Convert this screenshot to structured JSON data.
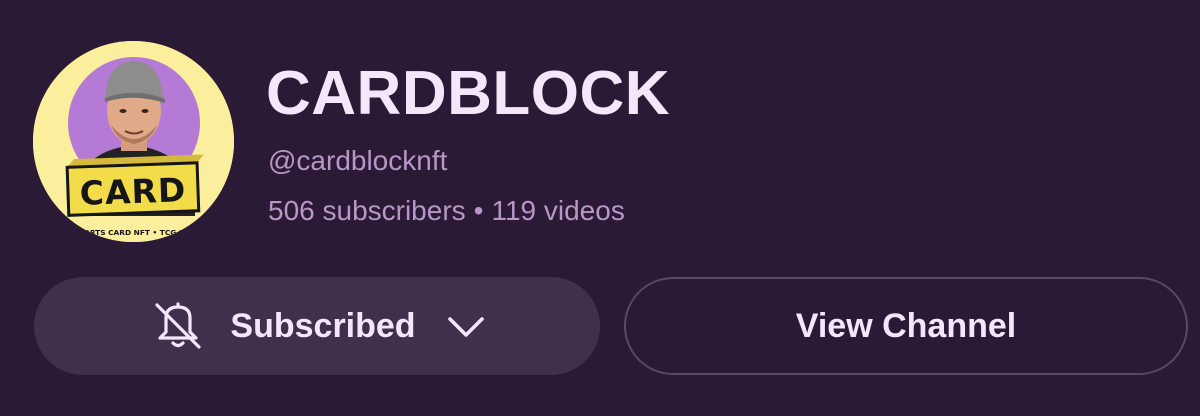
{
  "channel": {
    "name": "CARDBLOCK",
    "handle": "@cardblocknft",
    "subscribers": "506 subscribers",
    "separator": "•",
    "videos": "119 videos"
  },
  "avatar": {
    "badge_text": "CARD",
    "tagline": "SPORTS CARD NFT • TCG NFT",
    "colors": {
      "background": "#fbee9c",
      "circle": "#b57ad6",
      "badge": "#f3dc4a"
    }
  },
  "actions": {
    "subscribed_label": "Subscribed",
    "view_channel_label": "View Channel"
  },
  "icons": {
    "notifications": "bell-off-icon",
    "dropdown": "chevron-down-icon"
  },
  "colors": {
    "background": "#2b1a35",
    "title": "#f6e6fb",
    "muted_text": "#b797c6",
    "subscribed_button": "#41304c",
    "outline_button_border": "#5a4764"
  }
}
